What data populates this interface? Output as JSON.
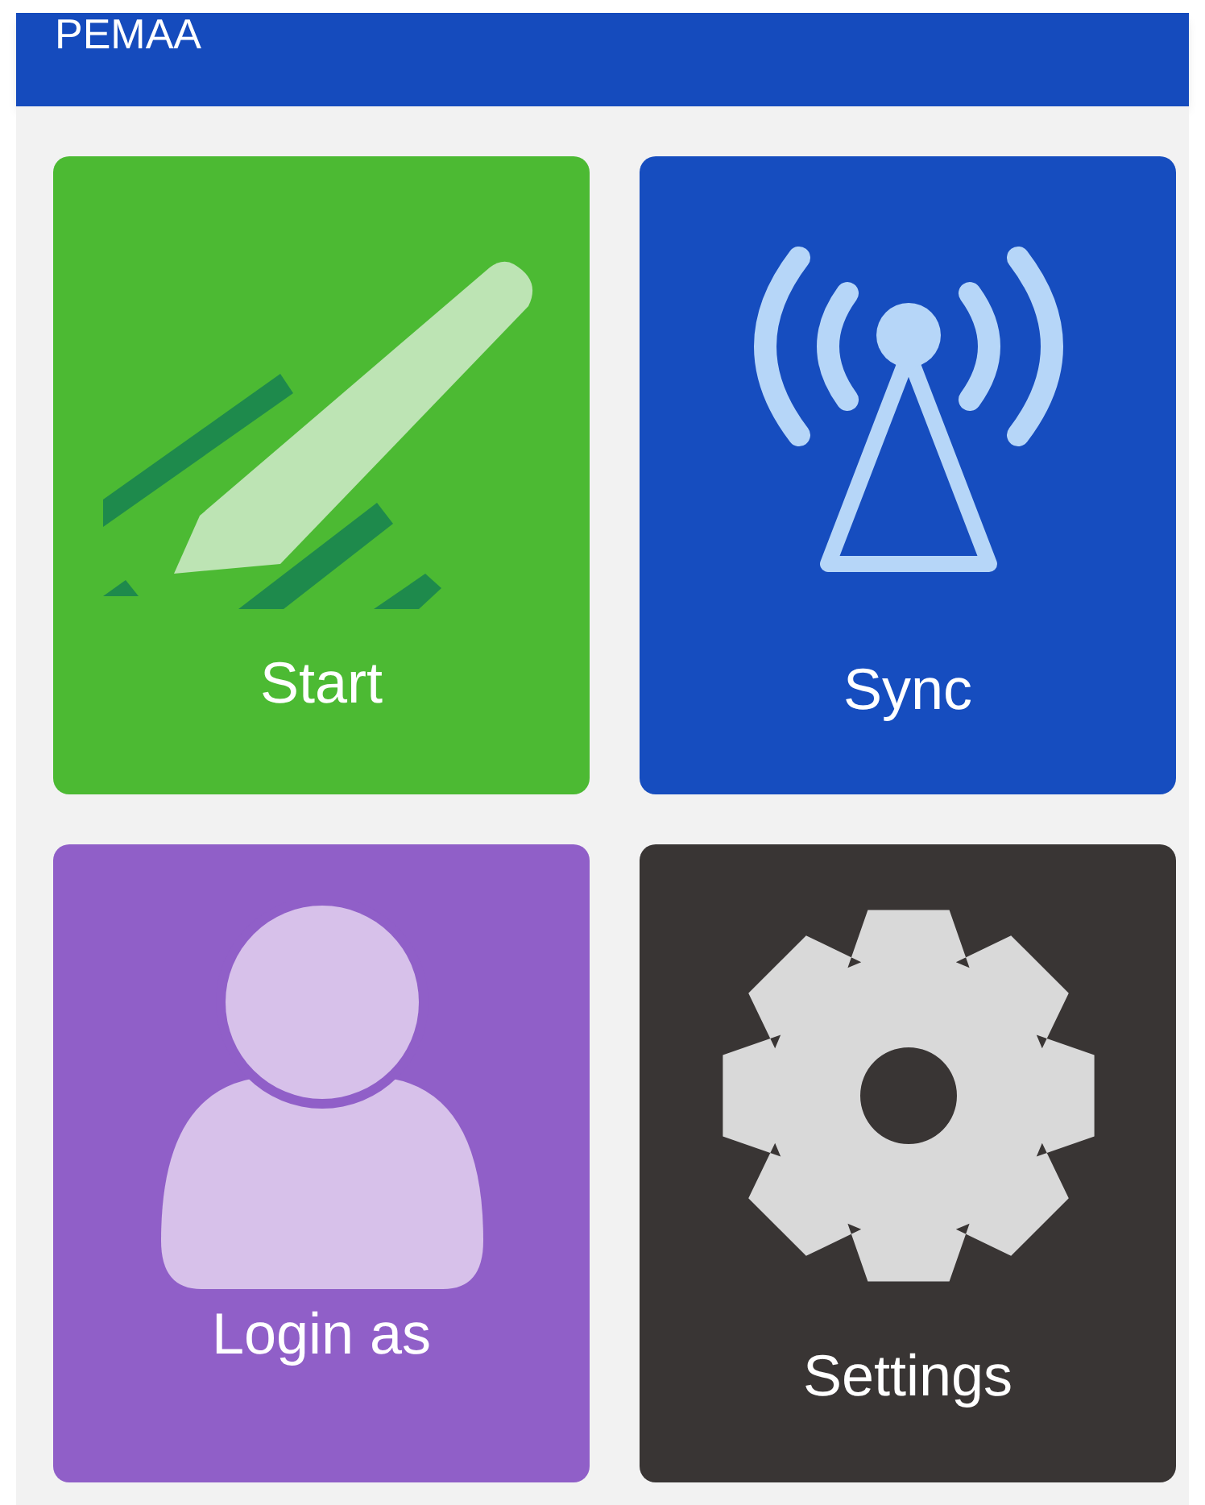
{
  "header": {
    "title": "PEMAA"
  },
  "tiles": [
    {
      "label": "Start",
      "kind": "pencil",
      "color": "#4cba33"
    },
    {
      "label": "Sync",
      "kind": "antenna",
      "color": "#164dbf"
    },
    {
      "label": "Login as",
      "kind": "person",
      "color": "#905fc8"
    },
    {
      "label": "Settings",
      "kind": "gear",
      "color": "#393534"
    }
  ]
}
